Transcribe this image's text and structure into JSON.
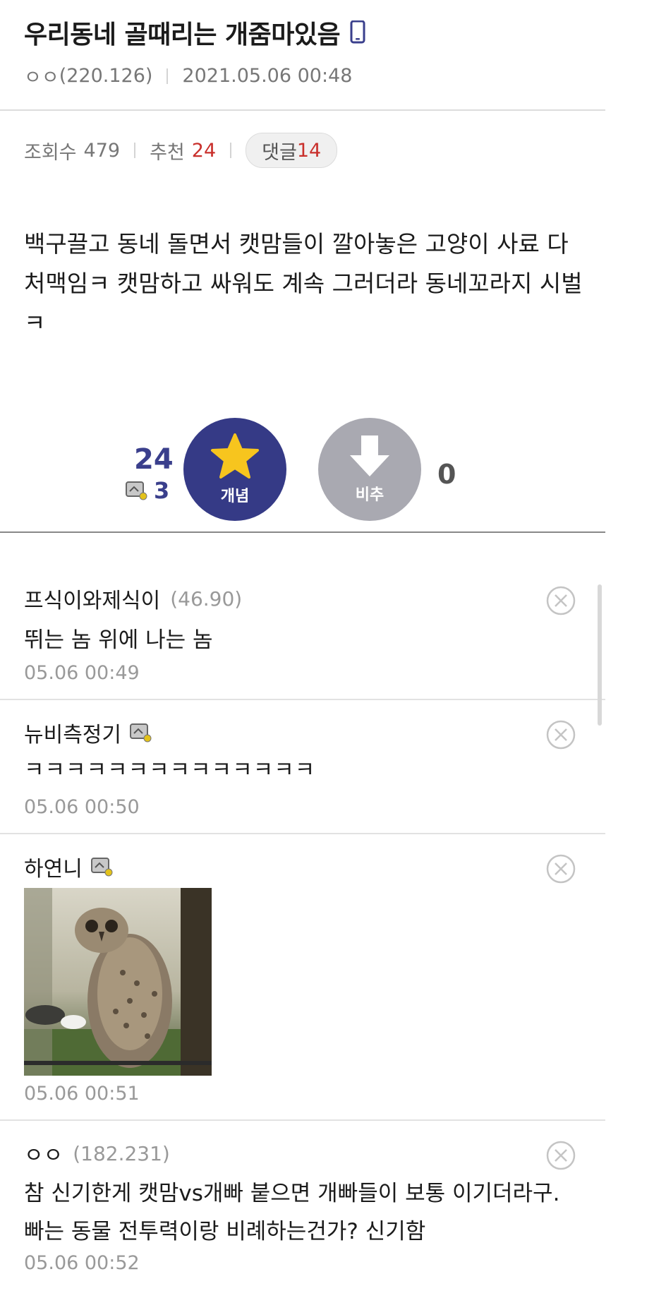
{
  "post": {
    "title": "우리동네 골때리는 개줌마있음",
    "author": "ㅇㅇ",
    "author_ip": "(220.126)",
    "datetime": "2021.05.06 00:48",
    "views_label": "조회수",
    "views": "479",
    "recommend_label": "추천",
    "recommend": "24",
    "comments_label": "댓글",
    "comments": "14",
    "body": "백구끌고 동네 돌면서 캣맘들이 깔아놓은 고양이 사료 다처맥임ㅋ 캣맘하고 싸워도 계속 그러더라 동네꼬라지 시벌ㅋ"
  },
  "vote": {
    "up_count": "24",
    "fixed_count": "3",
    "up_label": "개념",
    "down_label": "비추",
    "down_count": "0"
  },
  "comments": [
    {
      "author": "프식이와제식이",
      "ip": "(46.90)",
      "text": "뛰는 놈 위에 나는 놈",
      "date": "05.06 00:49"
    },
    {
      "author": "뉴비측정기",
      "ip": "",
      "text": "ㅋㅋㅋㅋㅋㅋㅋㅋㅋㅋㅋㅋㅋㅋ",
      "date": "05.06 00:50"
    },
    {
      "author": "하연니",
      "ip": "",
      "text": "",
      "date": "05.06 00:51"
    },
    {
      "author": "ㅇㅇ",
      "ip": "(182.231)",
      "text": "참 신기한게 캣맘vs개빠 붙으면 개빠들이 보통 이기더라구. 빠는 동물 전투력이랑 비례하는건가? 신기함",
      "date": "05.06 00:52"
    }
  ],
  "colors": {
    "accent": "#353a86",
    "red": "#c9302c",
    "down": "#a9a9b1"
  }
}
